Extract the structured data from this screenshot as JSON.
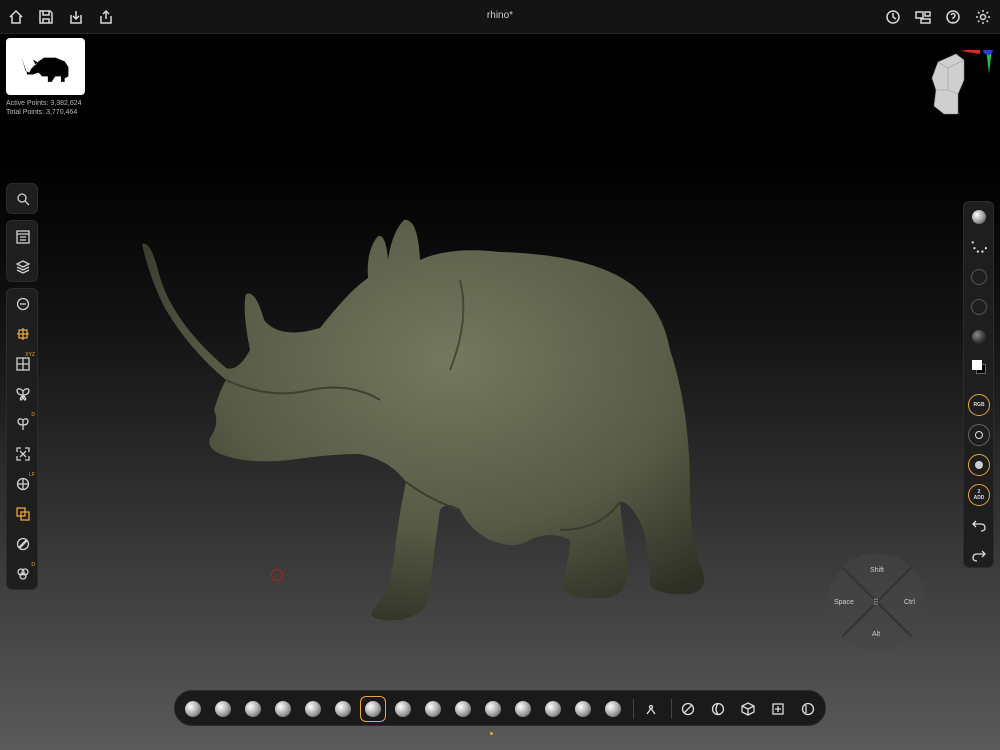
{
  "window": {
    "title": "rhino*"
  },
  "stats": {
    "active_label": "Active Points: 3,382,624",
    "total_label": "Total Points: 3,770,464"
  },
  "top_left_icons": [
    "home-icon",
    "save-icon",
    "import-icon",
    "share-icon"
  ],
  "top_right_icons": [
    "history-icon",
    "layout-icon",
    "help-icon",
    "settings-icon"
  ],
  "left_tools": {
    "badges": {
      "xyz": "XYZ",
      "d": "D",
      "lf": "LF",
      "d2": "D"
    }
  },
  "right_tools": {
    "rgb_label": "RGB",
    "add_label": "ADD",
    "add_value": "2"
  },
  "modifiers": {
    "shift": "Shift",
    "space": "Space",
    "ctrl": "Ctrl",
    "alt": "Alt"
  },
  "colors": {
    "accent": "#e8a53a",
    "model": "#5b5e48",
    "topbar": "#141414",
    "panel": "#1e1e1e"
  },
  "brushes": [
    "Standard",
    "ClayBuildup",
    "Inflate",
    "Smooth",
    "Move",
    "Pinch",
    "DamStandard",
    "Polish",
    "Flatten",
    "Blob",
    "SnakeHook",
    "Planar",
    "TrimDynamic",
    "Chisel",
    "Curve"
  ],
  "selected_brush_index": 6,
  "page_dots": 3
}
